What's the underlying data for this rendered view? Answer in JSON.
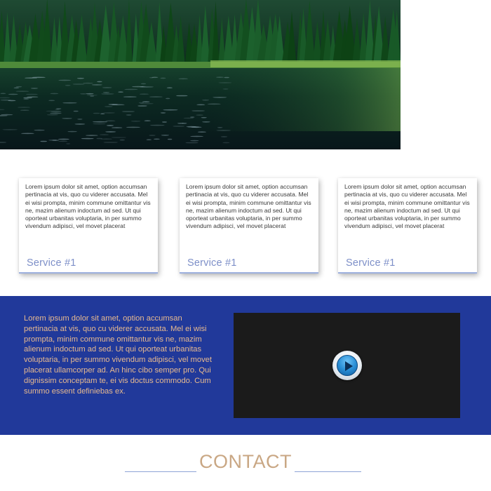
{
  "hero": {
    "image": "forest-lake-photo"
  },
  "services": [
    {
      "text": "Lorem ipsum dolor sit amet, option accumsan pertinacia at vis, quo cu viderer accusata. Mel ei wisi prompta, minim commune omittantur vis ne, mazim alienum indoctum ad sed. Ut qui oporteat urbanitas voluptaria, in per summo vivendum adipisci, vel movet placerat",
      "title": "Service #1"
    },
    {
      "text": "Lorem ipsum dolor sit amet, option accumsan pertinacia at vis, quo cu viderer accusata. Mel ei wisi prompta, minim commune omittantur vis ne, mazim alienum indoctum ad sed. Ut qui oporteat urbanitas voluptaria, in per summo vivendum adipisci, vel movet placerat",
      "title": "Service #1"
    },
    {
      "text": "Lorem ipsum dolor sit amet, option accumsan pertinacia at vis, quo cu viderer accusata. Mel ei wisi prompta, minim commune omittantur vis ne, mazim alienum indoctum ad sed. Ut qui oporteat urbanitas voluptaria, in per summo vivendum adipisci, vel movet placerat",
      "title": "Service #1"
    }
  ],
  "band": {
    "text": "Lorem ipsum dolor sit amet, option accumsan pertinacia at vis, quo cu viderer accusata. Mel ei wisi prompta, minim commune omittantur vis ne, mazim alienum indoctum ad sed. Ut qui oporteat urbanitas voluptaria, in per summo vivendum adipisci, vel movet placerat ullamcorper ad. An hinc cibo semper pro. Qui dignissim conceptam te, ei vis doctus commodo. Cum summo essent definiebas ex.",
    "video": {
      "icon": "play-icon"
    }
  },
  "contact": {
    "title": "CONTACT"
  },
  "colors": {
    "band_bg": "#21399a",
    "band_text": "#e6b98f",
    "service_title": "#7d8fc8",
    "contact_title": "#c9a784",
    "card_accent": "#9db0de"
  }
}
